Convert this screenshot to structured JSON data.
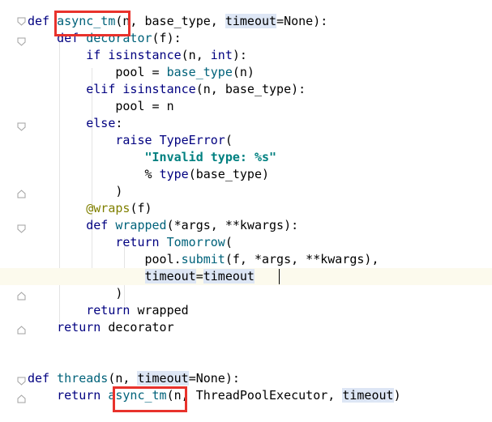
{
  "code_lines": [
    {
      "tokens": [
        [
          "kw",
          "def "
        ],
        [
          "fn",
          "async_tm"
        ],
        [
          "pn",
          "(n, base_type, "
        ],
        [
          "hl",
          "timeout"
        ],
        [
          "pn",
          "=None):"
        ]
      ]
    },
    {
      "tokens": [
        [
          "pn",
          "    "
        ],
        [
          "kw",
          "def "
        ],
        [
          "fn",
          "decorator"
        ],
        [
          "pn",
          "(f):"
        ]
      ]
    },
    {
      "tokens": [
        [
          "pn",
          "        "
        ],
        [
          "kw",
          "if "
        ],
        [
          "bi",
          "isinstance"
        ],
        [
          "pn",
          "(n, "
        ],
        [
          "bi",
          "int"
        ],
        [
          "pn",
          "):"
        ]
      ]
    },
    {
      "tokens": [
        [
          "pn",
          "            pool = "
        ],
        [
          "fn",
          "base_type"
        ],
        [
          "pn",
          "(n)"
        ]
      ]
    },
    {
      "tokens": [
        [
          "pn",
          "        "
        ],
        [
          "kw",
          "elif "
        ],
        [
          "bi",
          "isinstance"
        ],
        [
          "pn",
          "(n, base_type):"
        ]
      ]
    },
    {
      "tokens": [
        [
          "pn",
          "            pool = n"
        ]
      ]
    },
    {
      "tokens": [
        [
          "pn",
          "        "
        ],
        [
          "kw",
          "else"
        ],
        [
          "pn",
          ":"
        ]
      ]
    },
    {
      "tokens": [
        [
          "pn",
          "            "
        ],
        [
          "kw",
          "raise "
        ],
        [
          "bi",
          "TypeError"
        ],
        [
          "pn",
          "("
        ]
      ]
    },
    {
      "tokens": [
        [
          "pn",
          "                "
        ],
        [
          "str",
          "\"Invalid type: %s\""
        ]
      ]
    },
    {
      "tokens": [
        [
          "pn",
          "                % "
        ],
        [
          "bi",
          "type"
        ],
        [
          "pn",
          "(base_type)"
        ]
      ]
    },
    {
      "tokens": [
        [
          "pn",
          "            )"
        ]
      ]
    },
    {
      "tokens": [
        [
          "pn",
          "        "
        ],
        [
          "deco",
          "@wraps"
        ],
        [
          "pn",
          "(f)"
        ]
      ]
    },
    {
      "tokens": [
        [
          "pn",
          "        "
        ],
        [
          "kw",
          "def "
        ],
        [
          "fn",
          "wrapped"
        ],
        [
          "pn",
          "(*args, **kwargs):"
        ]
      ]
    },
    {
      "tokens": [
        [
          "pn",
          "            "
        ],
        [
          "kw",
          "return "
        ],
        [
          "fn",
          "Tomorrow"
        ],
        [
          "pn",
          "("
        ]
      ]
    },
    {
      "tokens": [
        [
          "pn",
          "                pool."
        ],
        [
          "fn",
          "submit"
        ],
        [
          "pn",
          "(f, *args, **kwargs),"
        ]
      ]
    },
    {
      "tokens": [
        [
          "pn",
          "                "
        ],
        [
          "hl",
          "timeout"
        ],
        [
          "pn",
          "="
        ],
        [
          "hl",
          "timeout"
        ]
      ]
    },
    {
      "tokens": [
        [
          "pn",
          "            )"
        ]
      ]
    },
    {
      "tokens": [
        [
          "pn",
          "        "
        ],
        [
          "kw",
          "return "
        ],
        [
          "pn",
          "wrapped"
        ]
      ]
    },
    {
      "tokens": [
        [
          "pn",
          "    "
        ],
        [
          "kw",
          "return "
        ],
        [
          "pn",
          "decorator"
        ]
      ]
    },
    {
      "tokens": []
    },
    {
      "tokens": []
    },
    {
      "tokens": [
        [
          "kw",
          "def "
        ],
        [
          "fn",
          "threads"
        ],
        [
          "pn",
          "(n, "
        ],
        [
          "hl",
          "timeout"
        ],
        [
          "pn",
          "=None):"
        ]
      ]
    },
    {
      "tokens": [
        [
          "pn",
          "    "
        ],
        [
          "kw",
          "return "
        ],
        [
          "fn",
          "async_tm"
        ],
        [
          "pn",
          "(n, ThreadPoolExecutor, "
        ],
        [
          "hl",
          "timeout"
        ],
        [
          "pn",
          ")"
        ]
      ]
    }
  ],
  "current_line_index": 15,
  "annotation_color": "#e8322c"
}
